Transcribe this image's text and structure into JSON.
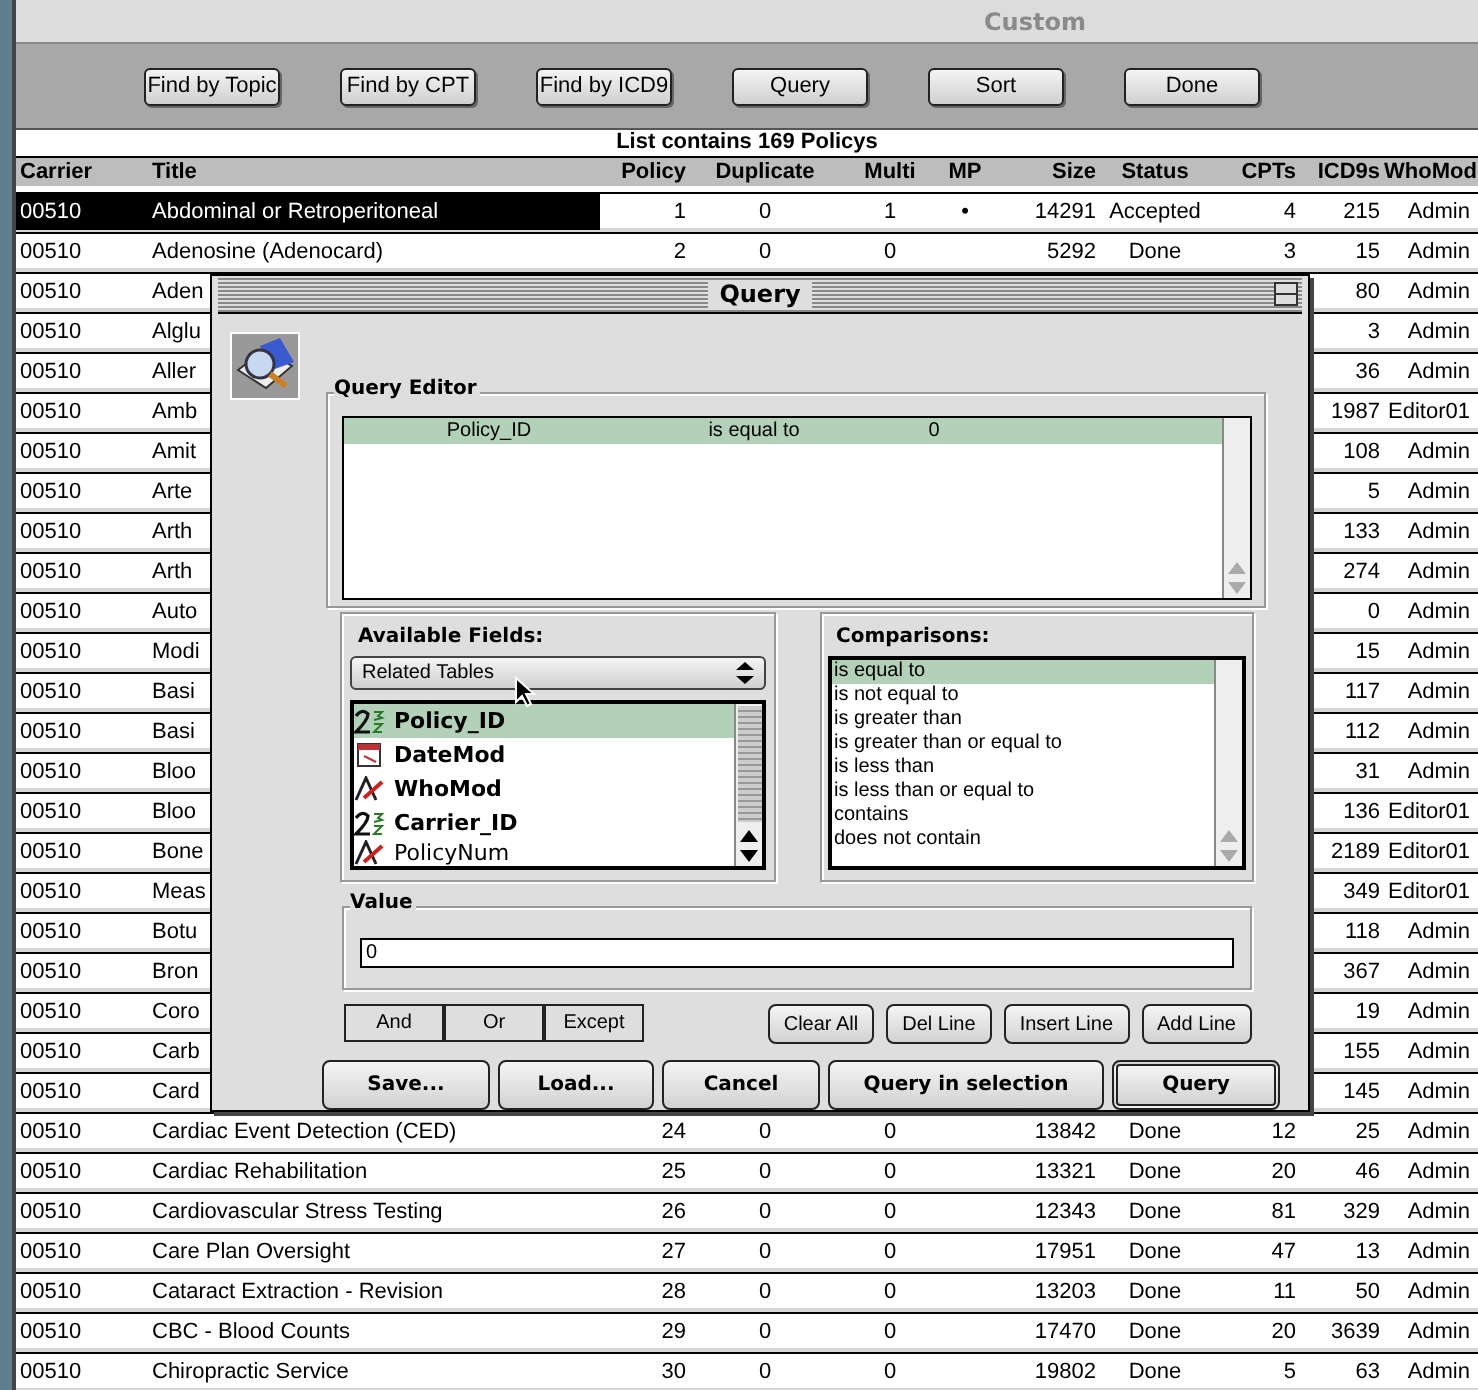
{
  "window": {
    "title": "Custom"
  },
  "toolbar": [
    "Find by Topic",
    "Find by CPT",
    "Find by ICD9",
    "Query",
    "Sort",
    "Done"
  ],
  "list_summary": "List contains 169 Policys",
  "columns": [
    "Carrier",
    "Title",
    "Policy",
    "Duplicate",
    "Multi",
    "MP",
    "Size",
    "Status",
    "CPTs",
    "ICD9s",
    "WhoMod"
  ],
  "rows": [
    {
      "carrier": "00510",
      "title": "Abdominal or Retroperitoneal",
      "policy": "1",
      "duplicate": "0",
      "multi": "1",
      "mp": "•",
      "size": "14291",
      "status": "Accepted",
      "cpts": "4",
      "icd9s": "215",
      "whomod": "Admin",
      "selected": true
    },
    {
      "carrier": "00510",
      "title": "Adenosine (Adenocard)",
      "policy": "2",
      "duplicate": "0",
      "multi": "0",
      "size": "5292",
      "status": "Done",
      "cpts": "3",
      "icd9s": "15",
      "whomod": "Admin",
      "selected": false
    },
    {
      "carrier": "00510",
      "title": "Aden",
      "icd9s": "80",
      "whomod": "Admin",
      "selected": false
    },
    {
      "carrier": "00510",
      "title": "Alglu",
      "icd9s": "3",
      "whomod": "Admin",
      "selected": false
    },
    {
      "carrier": "00510",
      "title": "Aller",
      "icd9s": "36",
      "whomod": "Admin",
      "selected": false
    },
    {
      "carrier": "00510",
      "title": "Amb",
      "icd9s": "1987",
      "whomod": "Editor01",
      "selected": false
    },
    {
      "carrier": "00510",
      "title": "Amit",
      "icd9s": "108",
      "whomod": "Admin",
      "selected": false
    },
    {
      "carrier": "00510",
      "title": "Arte",
      "icd9s": "5",
      "whomod": "Admin",
      "selected": false
    },
    {
      "carrier": "00510",
      "title": "Arth",
      "icd9s": "133",
      "whomod": "Admin",
      "selected": false
    },
    {
      "carrier": "00510",
      "title": "Arth",
      "icd9s": "274",
      "whomod": "Admin",
      "selected": false
    },
    {
      "carrier": "00510",
      "title": "Auto",
      "icd9s": "0",
      "whomod": "Admin",
      "selected": false
    },
    {
      "carrier": "00510",
      "title": "Modi",
      "icd9s": "15",
      "whomod": "Admin",
      "selected": false
    },
    {
      "carrier": "00510",
      "title": "Basi",
      "icd9s": "117",
      "whomod": "Admin",
      "selected": false
    },
    {
      "carrier": "00510",
      "title": "Basi",
      "icd9s": "112",
      "whomod": "Admin",
      "selected": false
    },
    {
      "carrier": "00510",
      "title": "Bloo",
      "icd9s": "31",
      "whomod": "Admin",
      "selected": false
    },
    {
      "carrier": "00510",
      "title": "Bloo",
      "icd9s": "136",
      "whomod": "Editor01",
      "selected": false
    },
    {
      "carrier": "00510",
      "title": "Bone",
      "icd9s": "2189",
      "whomod": "Editor01",
      "selected": false
    },
    {
      "carrier": "00510",
      "title": "Meas",
      "icd9s": "349",
      "whomod": "Editor01",
      "selected": false
    },
    {
      "carrier": "00510",
      "title": "Botu",
      "icd9s": "118",
      "whomod": "Admin",
      "selected": false
    },
    {
      "carrier": "00510",
      "title": "Bron",
      "icd9s": "367",
      "whomod": "Admin",
      "selected": false
    },
    {
      "carrier": "00510",
      "title": "Coro",
      "icd9s": "19",
      "whomod": "Admin",
      "selected": false
    },
    {
      "carrier": "00510",
      "title": "Carb",
      "icd9s": "155",
      "whomod": "Admin",
      "selected": false
    },
    {
      "carrier": "00510",
      "title": "Card",
      "icd9s": "145",
      "whomod": "Admin",
      "selected": false
    },
    {
      "carrier": "00510",
      "title": "Cardiac Event Detection (CED)",
      "policy": "24",
      "duplicate": "0",
      "multi": "0",
      "size": "13842",
      "status": "Done",
      "cpts": "12",
      "icd9s": "25",
      "whomod": "Admin",
      "selected": false
    },
    {
      "carrier": "00510",
      "title": "Cardiac Rehabilitation",
      "policy": "25",
      "duplicate": "0",
      "multi": "0",
      "size": "13321",
      "status": "Done",
      "cpts": "20",
      "icd9s": "46",
      "whomod": "Admin",
      "selected": false
    },
    {
      "carrier": "00510",
      "title": "Cardiovascular Stress Testing",
      "policy": "26",
      "duplicate": "0",
      "multi": "0",
      "size": "12343",
      "status": "Done",
      "cpts": "81",
      "icd9s": "329",
      "whomod": "Admin",
      "selected": false
    },
    {
      "carrier": "00510",
      "title": "Care Plan Oversight",
      "policy": "27",
      "duplicate": "0",
      "multi": "0",
      "size": "17951",
      "status": "Done",
      "cpts": "47",
      "icd9s": "13",
      "whomod": "Admin",
      "selected": false
    },
    {
      "carrier": "00510",
      "title": "Cataract Extraction - Revision",
      "policy": "28",
      "duplicate": "0",
      "multi": "0",
      "size": "13203",
      "status": "Done",
      "cpts": "11",
      "icd9s": "50",
      "whomod": "Admin",
      "selected": false
    },
    {
      "carrier": "00510",
      "title": "CBC - Blood Counts",
      "policy": "29",
      "duplicate": "0",
      "multi": "0",
      "size": "17470",
      "status": "Done",
      "cpts": "20",
      "icd9s": "3639",
      "whomod": "Admin",
      "selected": false
    },
    {
      "carrier": "00510",
      "title": "Chiropractic Service",
      "policy": "30",
      "duplicate": "0",
      "multi": "0",
      "size": "19802",
      "status": "Done",
      "cpts": "5",
      "icd9s": "63",
      "whomod": "Admin",
      "selected": false
    }
  ],
  "dialog": {
    "title": "Query",
    "query_editor": {
      "label": "Query Editor",
      "lines": [
        {
          "field": "Policy_ID",
          "comparison": "is equal to",
          "value": "0",
          "selected": true
        }
      ]
    },
    "available_fields": {
      "label": "Available Fields:",
      "table_menu": "Related Tables",
      "fields": [
        {
          "name": "Policy_ID",
          "kind": "number",
          "indexed": true,
          "selected": true
        },
        {
          "name": "DateMod",
          "kind": "date",
          "indexed": true,
          "selected": false
        },
        {
          "name": "WhoMod",
          "kind": "text",
          "indexed": true,
          "selected": false
        },
        {
          "name": "Carrier_ID",
          "kind": "number",
          "indexed": true,
          "selected": false
        },
        {
          "name": "PolicyNum",
          "kind": "text",
          "indexed": false,
          "selected": false
        }
      ]
    },
    "comparisons": {
      "label": "Comparisons:",
      "items": [
        {
          "label": "is equal to",
          "selected": true
        },
        {
          "label": "is not equal to",
          "selected": false
        },
        {
          "label": "is greater than",
          "selected": false
        },
        {
          "label": "is greater than or equal to",
          "selected": false
        },
        {
          "label": "is less than",
          "selected": false
        },
        {
          "label": "is less than or equal to",
          "selected": false
        },
        {
          "label": "contains",
          "selected": false
        },
        {
          "label": "does not contain",
          "selected": false
        }
      ]
    },
    "value": {
      "label": "Value",
      "text": "0"
    },
    "conjunctions": [
      "And",
      "Or",
      "Except"
    ],
    "line_buttons": [
      "Clear All",
      "Del Line",
      "Insert Line",
      "Add Line"
    ],
    "buttons": [
      {
        "label": "Save...",
        "default": false
      },
      {
        "label": "Load...",
        "default": false
      },
      {
        "label": "Cancel",
        "default": false
      },
      {
        "label": "Query in selection",
        "default": false
      },
      {
        "label": "Query",
        "default": true
      }
    ]
  }
}
